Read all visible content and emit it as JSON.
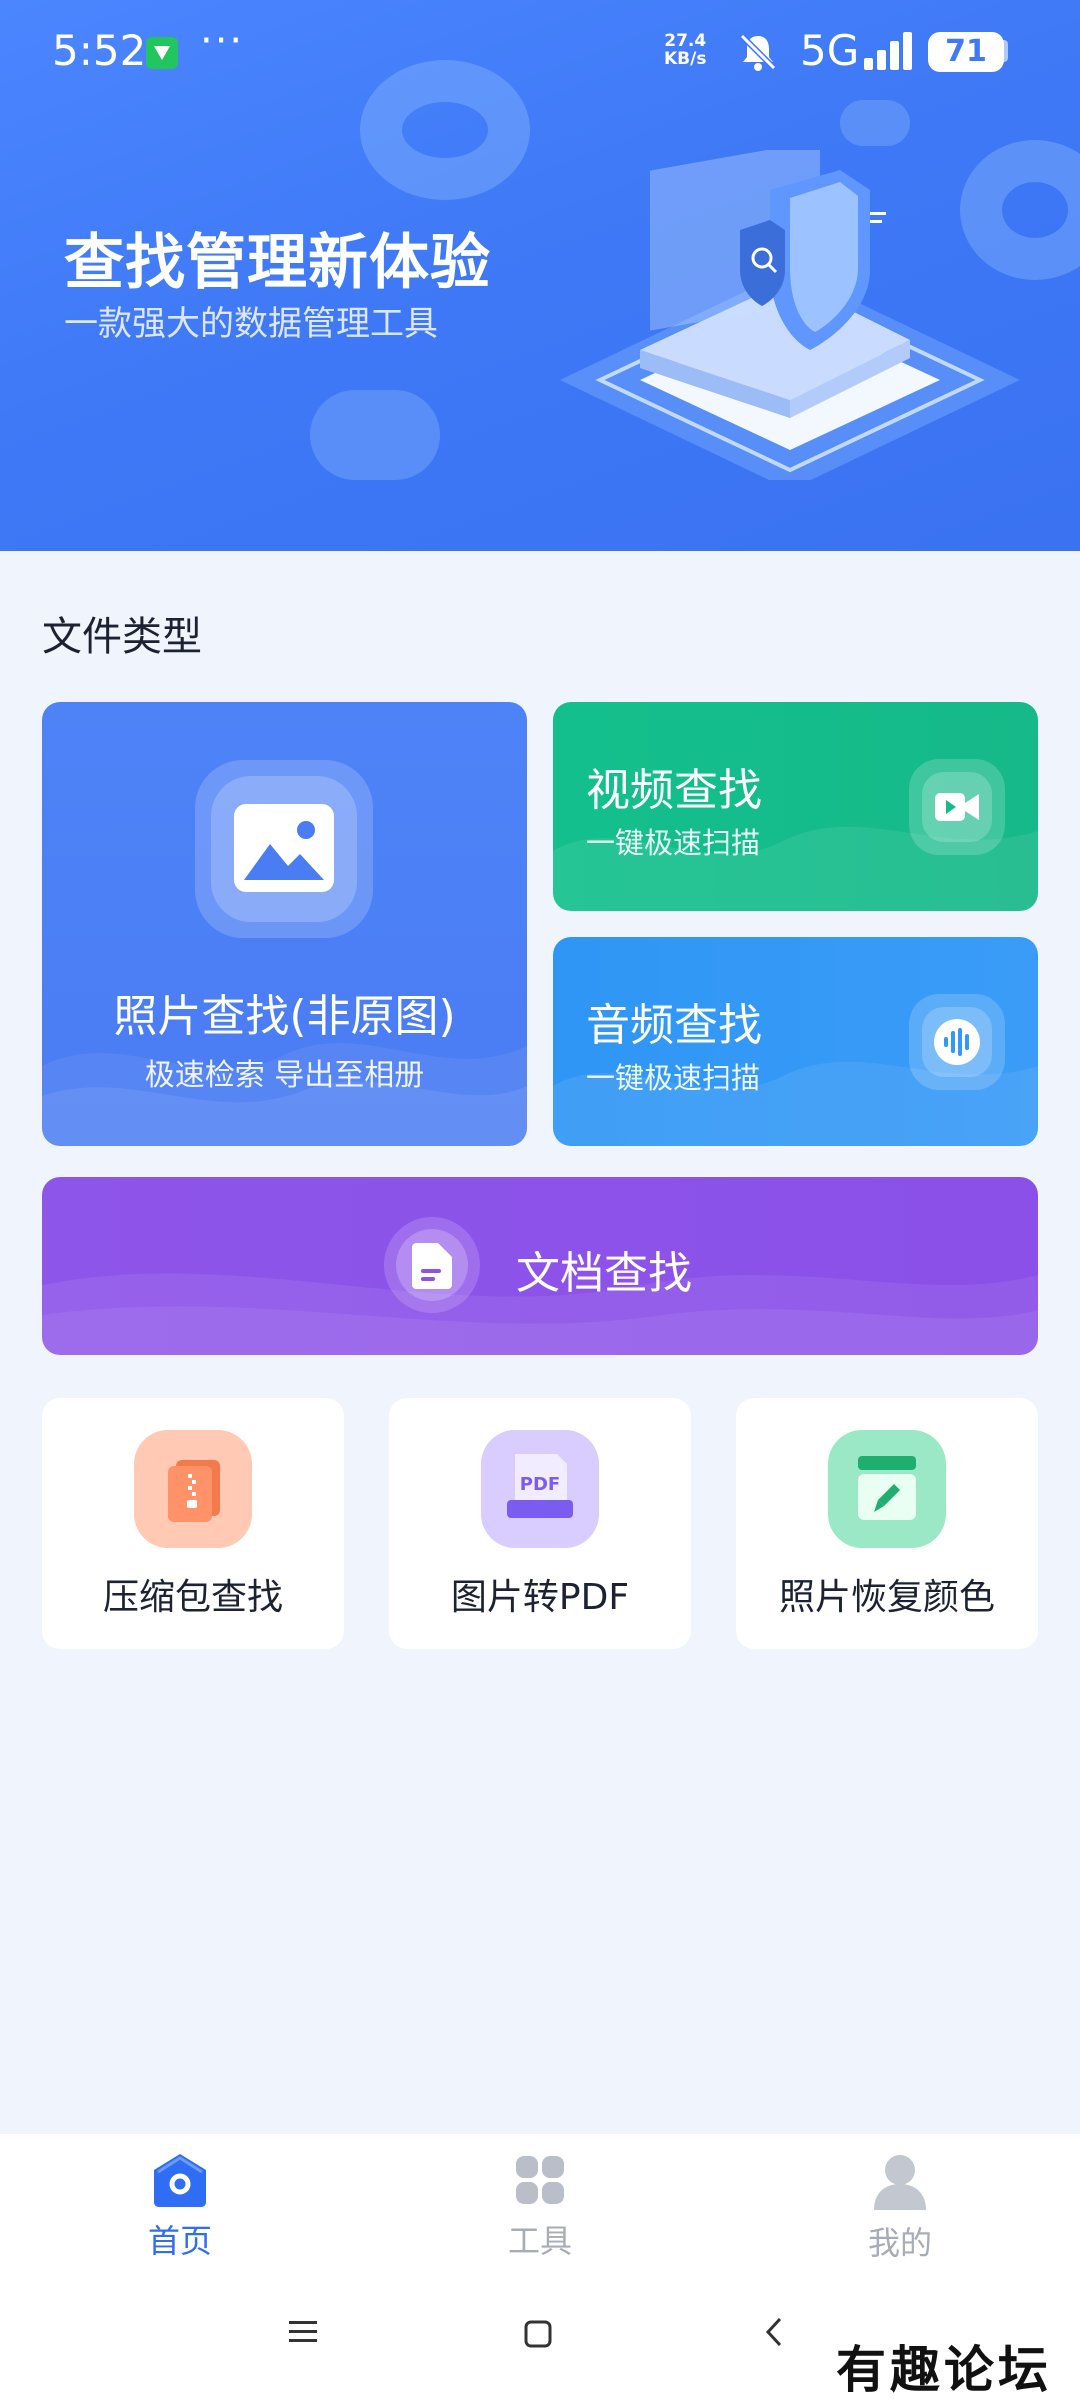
{
  "status_bar": {
    "time": "5:52",
    "more": "···",
    "speed_value": "27.4",
    "speed_unit": "KB/s",
    "network": "5G",
    "battery": "71"
  },
  "banner": {
    "title": "查找管理新体验",
    "subtitle": "一款强大的数据管理工具"
  },
  "section": {
    "title": "文件类型"
  },
  "cards": {
    "photo": {
      "title": "照片查找(非原图)",
      "subtitle": "极速检索 导出至相册"
    },
    "video": {
      "title": "视频查找",
      "subtitle": "一键极速扫描"
    },
    "audio": {
      "title": "音频查找",
      "subtitle": "一键极速扫描"
    },
    "document": {
      "title": "文档查找"
    }
  },
  "tools": [
    {
      "label": "压缩包查找",
      "icon": "zip-icon"
    },
    {
      "label": "图片转PDF",
      "icon": "pdf-icon",
      "icon_text": "PDF"
    },
    {
      "label": "照片恢复颜色",
      "icon": "color-restore-icon"
    }
  ],
  "bottom_nav": {
    "home": "首页",
    "tools": "工具",
    "me": "我的",
    "active": "home"
  },
  "watermark": "有趣论坛",
  "colors": {
    "banner": "#3f79f6",
    "photo_card": "#4a7cf3",
    "video_card": "#13c08d",
    "audio_card": "#3399f6",
    "document_card": "#8c52e9",
    "nav_active": "#2f6df5",
    "nav_inactive": "#a7adb8"
  }
}
